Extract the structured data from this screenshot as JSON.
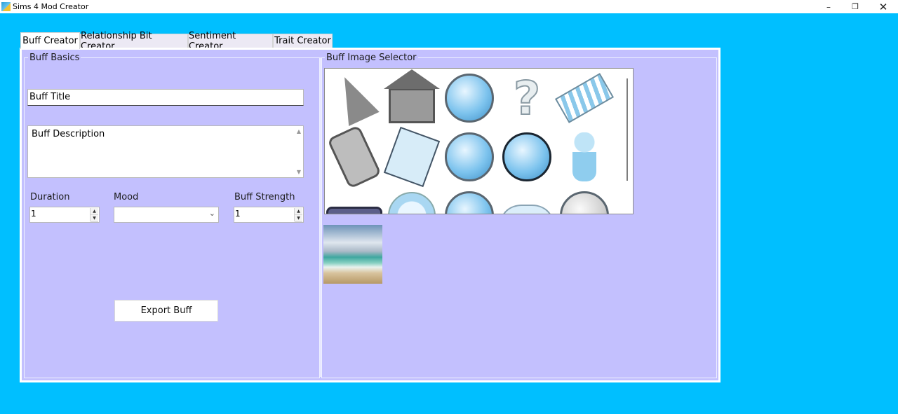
{
  "window": {
    "title": "Sims 4 Mod Creator"
  },
  "tabs": [
    {
      "label": "Buff Creator"
    },
    {
      "label": "Relationship Bit Creator"
    },
    {
      "label": "Sentiment Creator"
    },
    {
      "label": "Trait Creator"
    }
  ],
  "buff_basics": {
    "group_label": "Buff Basics",
    "title_value": "Buff Title",
    "description_value": "Buff Description",
    "duration_label": "Duration",
    "duration_value": "1",
    "mood_label": "Mood",
    "mood_value": "",
    "strength_label": "Buff Strength",
    "strength_value": "1",
    "export_label": "Export Buff"
  },
  "image_selector": {
    "group_label": "Buff Image Selector",
    "icons": [
      "party-hat-icon",
      "house-icon",
      "happy-face-icon",
      "question-mark-icon",
      "lounge-chair-icon",
      "phone-icon",
      "notepad-icon",
      "singing-face-icon",
      "crying-face-icon",
      "baby-icon",
      "chest-icon",
      "flame-icon",
      "dizzy-face-icon",
      "sleepy-icon",
      "sad-face-icon"
    ]
  },
  "colors": {
    "background": "#00bfff",
    "panel": "#c3c0fe"
  }
}
